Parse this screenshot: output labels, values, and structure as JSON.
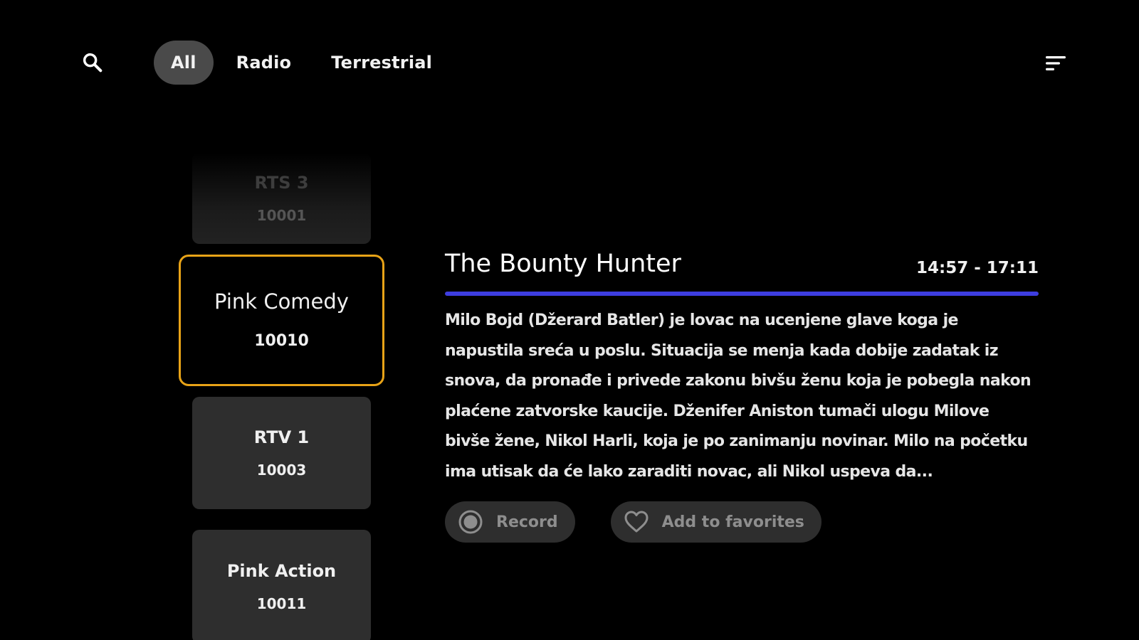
{
  "top_bar": {
    "search_icon": "search-icon",
    "tabs": [
      {
        "label": "All",
        "active": true
      },
      {
        "label": "Radio",
        "active": false
      },
      {
        "label": "Terrestrial",
        "active": false
      }
    ],
    "sort_icon": "sort-icon"
  },
  "channels": [
    {
      "name": "RTS 3",
      "number": "10001",
      "state": "faded"
    },
    {
      "name": "Pink Comedy",
      "number": "10010",
      "state": "selected"
    },
    {
      "name": "RTV 1",
      "number": "10003",
      "state": "normal"
    },
    {
      "name": "Pink Action",
      "number": "10011",
      "state": "normal"
    }
  ],
  "program": {
    "title": "The Bounty Hunter",
    "time": "14:57 - 17:11",
    "progress_percent": 100,
    "description": "Milo Bojd (Džerard Batler) je lovac na ucenjene glave koga je napustila sreća u poslu. Situacija se menja kada dobije zadatak iz snova, da pronađe i privede zakonu bivšu ženu koja je pobegla nakon plaćene zatvorske kaucije. Dženifer Aniston tumači ulogu Milove bivše žene, Nikol Harli, koja je po zanimanju novinar. Milo na početku ima utisak da će lako zaraditi novac, ali Nikol uspeva da..."
  },
  "actions": {
    "record_label": "Record",
    "record_icon": "record-icon",
    "favorites_label": "Add to favorites",
    "favorites_icon": "heart-icon"
  },
  "colors": {
    "background": "#000000",
    "card": "#2e2e2e",
    "selected_border": "#e8a317",
    "progress": "#3d3de0",
    "active_tab": "#4a4a4a"
  }
}
